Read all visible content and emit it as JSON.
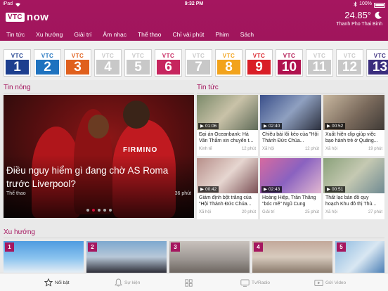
{
  "status_bar": {
    "device": "iPad",
    "time": "9:32 PM",
    "battery": "100%"
  },
  "header": {
    "logo_vtc": "VTC",
    "logo_now": "NOW",
    "temperature": "24.85°",
    "city": "Thanh Pho Thai Binh",
    "accent_color": "#a5165f"
  },
  "nav": [
    "Tin tức",
    "Xu hướng",
    "Giải trí",
    "Âm nhạc",
    "Thể thao",
    "Chỉ vài phút",
    "Phim",
    "Sách"
  ],
  "channels": [
    {
      "label": "VTC",
      "num": "1",
      "color": "#1d3f8f"
    },
    {
      "label": "VTC",
      "num": "2",
      "color": "#1e72bf"
    },
    {
      "label": "VTC",
      "num": "3",
      "color": "#e0601d"
    },
    {
      "label": "VTC",
      "num": "4",
      "color": "#c8c8c8"
    },
    {
      "label": "VTC",
      "num": "5",
      "color": "#c8c8c8"
    },
    {
      "label": "VTC",
      "num": "6",
      "color": "#c6255e"
    },
    {
      "label": "VTC",
      "num": "7",
      "color": "#c8c8c8"
    },
    {
      "label": "VTC",
      "num": "8",
      "color": "#f2a31c"
    },
    {
      "label": "VTC",
      "num": "9",
      "color": "#d91e26"
    },
    {
      "label": "VTC",
      "num": "10",
      "color": "#b0124e"
    },
    {
      "label": "VTC",
      "num": "11",
      "color": "#c8c8c8"
    },
    {
      "label": "VTC",
      "num": "12",
      "color": "#c8c8c8"
    },
    {
      "label": "VTC",
      "num": "13",
      "color": "#3a2d7d"
    }
  ],
  "hot": {
    "section_title": "Tin nóng",
    "title": "Điều nguy hiểm gì đang chờ AS Roma trước Liverpool?",
    "category": "Thể thao",
    "age": "36 phút",
    "slide_count": 5,
    "active_slide": 2
  },
  "news": {
    "section_title": "Tin tức",
    "items": [
      {
        "duration": "01:06",
        "title": "Đại án Oceanbank: Hà Văn Thắm xin chuyển t...",
        "category": "Kinh tế",
        "age": "12 phút"
      },
      {
        "duration": "02:40",
        "title": "Chiêu bài lôi kéo của \"Hội Thánh Đức Chúa...",
        "category": "Xã hội",
        "age": "12 phút"
      },
      {
        "duration": "00:52",
        "title": "Xuất hiện clip giúp việc bạo hành trẻ ở Quảng...",
        "category": "Xã hội",
        "age": "19 phút"
      },
      {
        "duration": "00:42",
        "title": "Giám định bột trắng của \"Hội Thánh Đức Chúa...",
        "category": "Xã hội",
        "age": "20 phút"
      },
      {
        "duration": "02:43",
        "title": "Hoàng Hiệp, Trần Thắng \"bóc mẽ\" Ngũ Cung",
        "category": "Giải trí",
        "age": "25 phút"
      },
      {
        "duration": "00:51",
        "title": "Thất lạc bản đồ quy hoạch Khu đô thị Thủ...",
        "category": "Xã hội",
        "age": "27 phút"
      }
    ]
  },
  "trending": {
    "section_title": "Xu hướng",
    "ranks": [
      "1",
      "2",
      "3",
      "4",
      "5"
    ]
  },
  "tabbar": [
    {
      "label": "Nổi bật",
      "icon": "star-icon"
    },
    {
      "label": "Sự kiện",
      "icon": "bell-icon"
    },
    {
      "label": "",
      "icon": "grid-icon"
    },
    {
      "label": "Tv/Radio",
      "icon": "tv-icon"
    },
    {
      "label": "Gửi Video",
      "icon": "send-video-icon"
    }
  ]
}
